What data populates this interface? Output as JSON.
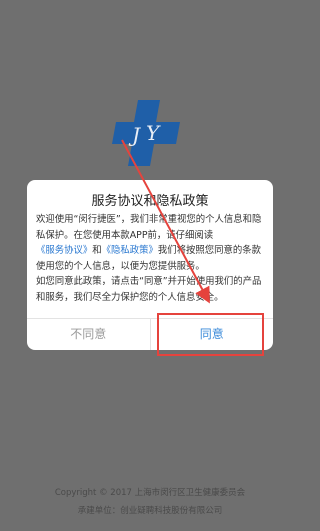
{
  "footer": {
    "copyright": "Copyright © 2017 上海市闵行区卫生健康委员会",
    "builder": "承建单位：创业疑聘科技股份有限公司"
  },
  "dialog": {
    "title": "服务协议和隐私政策",
    "p1_a": "欢迎使用“闵行捷医”，我们非常重视您的个人信息和隐私保护。在您使用本款APP前，请仔细阅读",
    "link_service": "《服务协议》",
    "p1_and": "和",
    "link_privacy": "《隐私政策》",
    "p1_b": "我们将按照您同意的条款使用您的个人信息，以便为您提供服务。",
    "p2": "如您同意此政策，请点击“同意”并开始使用我们的产品和服务，我们尽全力保护您的个人信息安全。",
    "disagree_label": "不同意",
    "agree_label": "同意"
  },
  "colors": {
    "overlay": "#6f6f6f",
    "link": "#2a78d0",
    "agree": "#3a8ad9",
    "annotation": "#e5433d",
    "logo": "#1f5fa8"
  },
  "icons": {
    "logo": "jy-cross-logo"
  }
}
